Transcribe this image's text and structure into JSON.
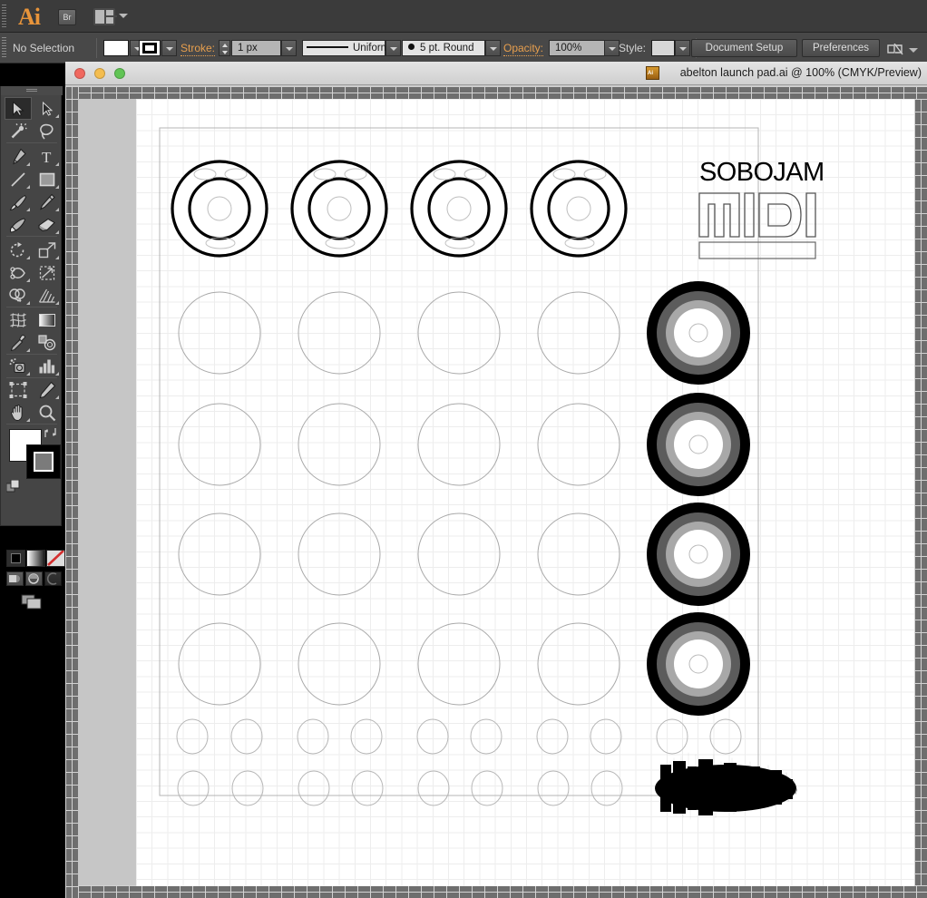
{
  "app": {
    "name": "Ai",
    "bridge_button": "Br",
    "arrange_icon": "arrange-documents-icon"
  },
  "control_bar": {
    "selection_status": "No Selection",
    "fill_swatch_color": "#ffffff",
    "stroke_label": "Stroke:",
    "stroke_weight": "1 px",
    "stroke_profile": "Uniform",
    "brush_definition": "5 pt. Round",
    "opacity_label": "Opacity:",
    "opacity_value": "100%",
    "style_label": "Style:",
    "document_setup_button": "Document Setup",
    "preferences_button": "Preferences",
    "overflow_icon": "panel-overflow-icon"
  },
  "tools": [
    {
      "id": "selection-tool",
      "label": "Selection",
      "selected": true,
      "has_flyout": false
    },
    {
      "id": "direct-selection-tool",
      "label": "Direct Selection",
      "selected": false,
      "has_flyout": true
    },
    {
      "id": "magic-wand-tool",
      "label": "Magic Wand",
      "selected": false,
      "has_flyout": false
    },
    {
      "id": "lasso-tool",
      "label": "Lasso",
      "selected": false,
      "has_flyout": false
    },
    {
      "id": "pen-tool",
      "label": "Pen",
      "selected": false,
      "has_flyout": true
    },
    {
      "id": "type-tool",
      "label": "Type",
      "selected": false,
      "has_flyout": true
    },
    {
      "id": "line-segment-tool",
      "label": "Line Segment",
      "selected": false,
      "has_flyout": true
    },
    {
      "id": "rectangle-tool",
      "label": "Rectangle",
      "selected": false,
      "has_flyout": true
    },
    {
      "id": "paintbrush-tool",
      "label": "Paintbrush",
      "selected": false,
      "has_flyout": true
    },
    {
      "id": "pencil-tool",
      "label": "Pencil",
      "selected": false,
      "has_flyout": true
    },
    {
      "id": "blob-brush-tool",
      "label": "Blob Brush",
      "selected": false,
      "has_flyout": false
    },
    {
      "id": "eraser-tool",
      "label": "Eraser",
      "selected": false,
      "has_flyout": true
    },
    {
      "id": "rotate-tool",
      "label": "Rotate",
      "selected": false,
      "has_flyout": true
    },
    {
      "id": "scale-tool",
      "label": "Scale",
      "selected": false,
      "has_flyout": true
    },
    {
      "id": "width-tool",
      "label": "Width",
      "selected": false,
      "has_flyout": true
    },
    {
      "id": "free-transform-tool",
      "label": "Free Transform",
      "selected": false,
      "has_flyout": false
    },
    {
      "id": "shape-builder-tool",
      "label": "Shape Builder",
      "selected": false,
      "has_flyout": true
    },
    {
      "id": "perspective-grid-tool",
      "label": "Perspective Grid",
      "selected": false,
      "has_flyout": true
    },
    {
      "id": "mesh-tool",
      "label": "Mesh",
      "selected": false,
      "has_flyout": false
    },
    {
      "id": "gradient-tool",
      "label": "Gradient",
      "selected": false,
      "has_flyout": false
    },
    {
      "id": "eyedropper-tool",
      "label": "Eyedropper",
      "selected": false,
      "has_flyout": true
    },
    {
      "id": "blend-tool",
      "label": "Blend",
      "selected": false,
      "has_flyout": false
    },
    {
      "id": "symbol-sprayer-tool",
      "label": "Symbol Sprayer",
      "selected": false,
      "has_flyout": true
    },
    {
      "id": "column-graph-tool",
      "label": "Column Graph",
      "selected": false,
      "has_flyout": true
    },
    {
      "id": "artboard-tool",
      "label": "Artboard",
      "selected": false,
      "has_flyout": false
    },
    {
      "id": "slice-tool",
      "label": "Slice",
      "selected": false,
      "has_flyout": true
    },
    {
      "id": "hand-tool",
      "label": "Hand",
      "selected": false,
      "has_flyout": true
    },
    {
      "id": "zoom-tool",
      "label": "Zoom",
      "selected": false,
      "has_flyout": false
    }
  ],
  "tool_options": {
    "fill_color": "#ffffff",
    "stroke_color": "#000000",
    "swap_icon": "swap-fill-stroke-icon",
    "default_icon": "default-fill-stroke-icon",
    "color_mode_icon": "color-icon",
    "gradient_mode_icon": "gradient-icon",
    "none_mode_icon": "none-icon",
    "draw_normal_icon": "draw-normal-icon",
    "draw_behind_icon": "draw-behind-icon",
    "draw_inside_icon": "draw-inside-icon",
    "screen_mode_icon": "change-screen-mode-icon"
  },
  "document": {
    "title": "abelton launch pad.ai @ 100% (CMYK/Preview)",
    "file_icon": "illustrator-file-icon",
    "traffic_lights": [
      {
        "name": "close-button",
        "color": "#f0685f"
      },
      {
        "name": "minimize-button",
        "color": "#f4bd4f"
      },
      {
        "name": "zoom-button",
        "color": "#61c455"
      }
    ],
    "zoom_level": "100%",
    "color_mode": "CMYK",
    "view_mode": "Preview"
  },
  "artwork": {
    "logo_text": "SOBOJAM",
    "logo_sub": "MIDI",
    "big_knobs": {
      "count": 4,
      "outline_color": "#000000",
      "note": "top row outlined knobs with 3 small vent ellipses"
    },
    "plain_pads": {
      "rows": 4,
      "cols": 4,
      "stroke_color": "#a8a8a8"
    },
    "filled_knobs": {
      "count": 4,
      "ring_colors": [
        "#000000",
        "#5a5a5a",
        "#a6a6a6",
        "#ffffff"
      ]
    },
    "small_pads": {
      "rows": 2,
      "per_row": 10,
      "stroke_color": "#b5b5b5"
    },
    "waveform": {
      "name": "audio-waveform-graphic",
      "color": "#000000"
    }
  }
}
